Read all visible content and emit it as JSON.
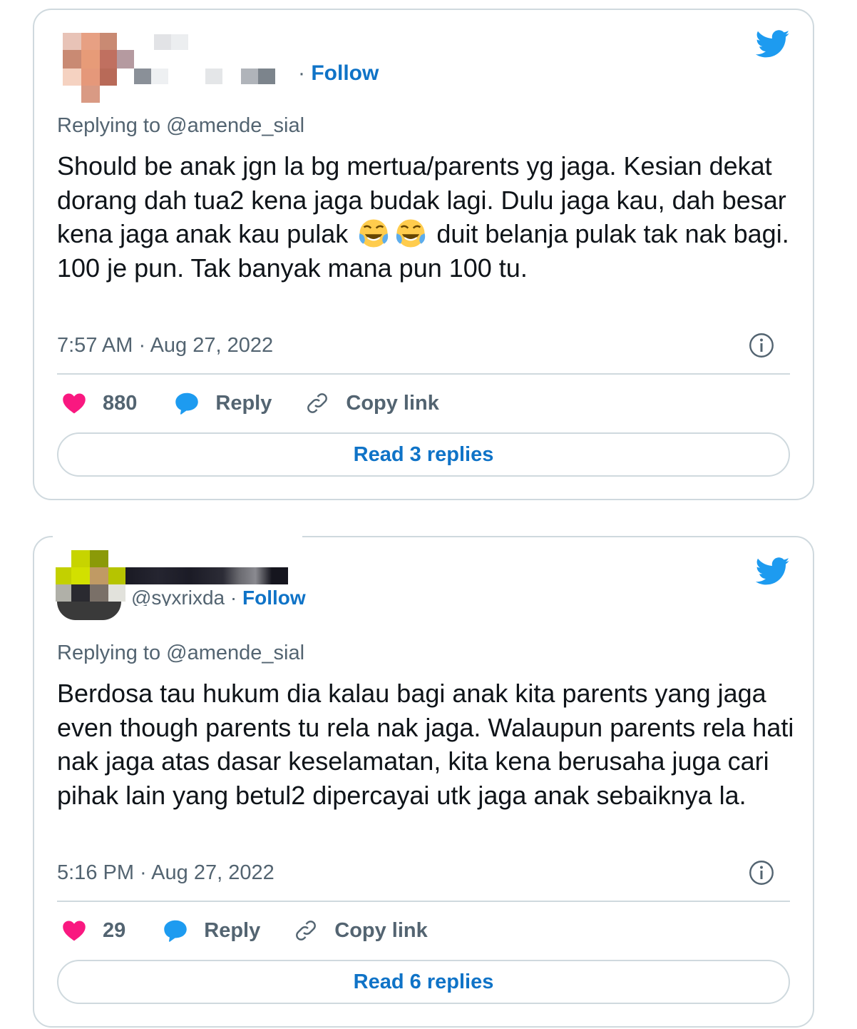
{
  "tweets": [
    {
      "follow_sep": "·",
      "follow_label": "Follow",
      "replying_to": "Replying to @amende_sial",
      "text_before_emoji": "Should be anak jgn la bg mertua/parents yg jaga. Kesian dekat dorang dah tua2 kena jaga budak lagi. Dulu jaga kau, dah besar kena jaga anak kau pulak",
      "emoji": "face-with-tears-of-joy x2",
      "text_after_emoji": "duit belanja pulak tak nak bagi. 100 je pun. Tak banyak mana pun 100 tu.",
      "timestamp": "7:57 AM · Aug 27, 2022",
      "likes": "880",
      "reply_label": "Reply",
      "copy_link_label": "Copy link",
      "read_replies": "Read 3 replies"
    },
    {
      "handle": "@syxrixda",
      "follow_sep": "·",
      "follow_label": "Follow",
      "replying_to": "Replying to @amende_sial",
      "text": "Berdosa tau hukum dia kalau bagi anak kita parents yang jaga even though parents tu rela nak jaga. Walaupun parents rela hati nak jaga atas dasar keselamatan, kita kena berusaha juga cari pihak lain yang betul2 dipercayai utk jaga anak sebaiknya la.",
      "timestamp": "5:16 PM · Aug 27, 2022",
      "likes": "29",
      "reply_label": "Reply",
      "copy_link_label": "Copy link",
      "read_replies": "Read 6 replies"
    }
  ],
  "colors": {
    "link_blue": "#0f73c7",
    "twitter_blue": "#1d9bf0",
    "like_pink": "#f91880",
    "muted_text": "#536471",
    "border": "#cfd9de"
  },
  "icons": [
    "twitter-bird-icon",
    "info-icon",
    "heart-icon",
    "speech-bubble-icon",
    "link-icon"
  ]
}
